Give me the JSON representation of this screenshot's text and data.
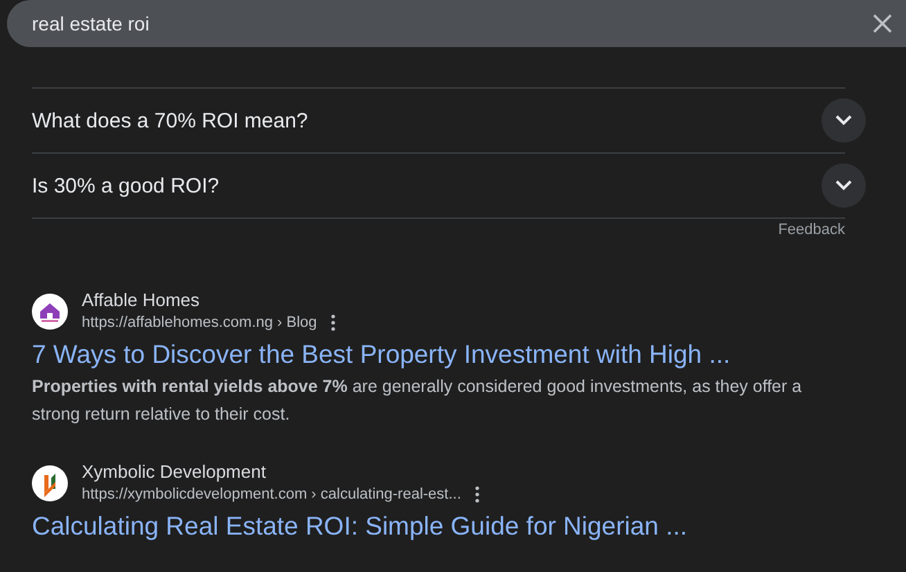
{
  "search": {
    "value": "real estate roi"
  },
  "questions": [
    {
      "text": "What does a 70% ROI mean?",
      "expanded": false
    },
    {
      "text": "Is 30% a good ROI?",
      "expanded": false
    }
  ],
  "feedback": "Feedback",
  "results": [
    {
      "site": "Affable Homes",
      "url": "https://affablehomes.com.ng › Blog",
      "title": "7 Ways to Discover the Best Property Investment with High ...",
      "snippet": "**Properties with rental yields above 7%** are generally considered good investments, as they offer a strong return relative to their cost.",
      "kind": "house"
    },
    {
      "site": "Xymbolic Development",
      "url": "https://xymbolicdevelopment.com › calculating-real-est...",
      "title": "Calculating Real Estate ROI: Simple Guide for Nigerian ...",
      "kind": "stripes"
    }
  ]
}
